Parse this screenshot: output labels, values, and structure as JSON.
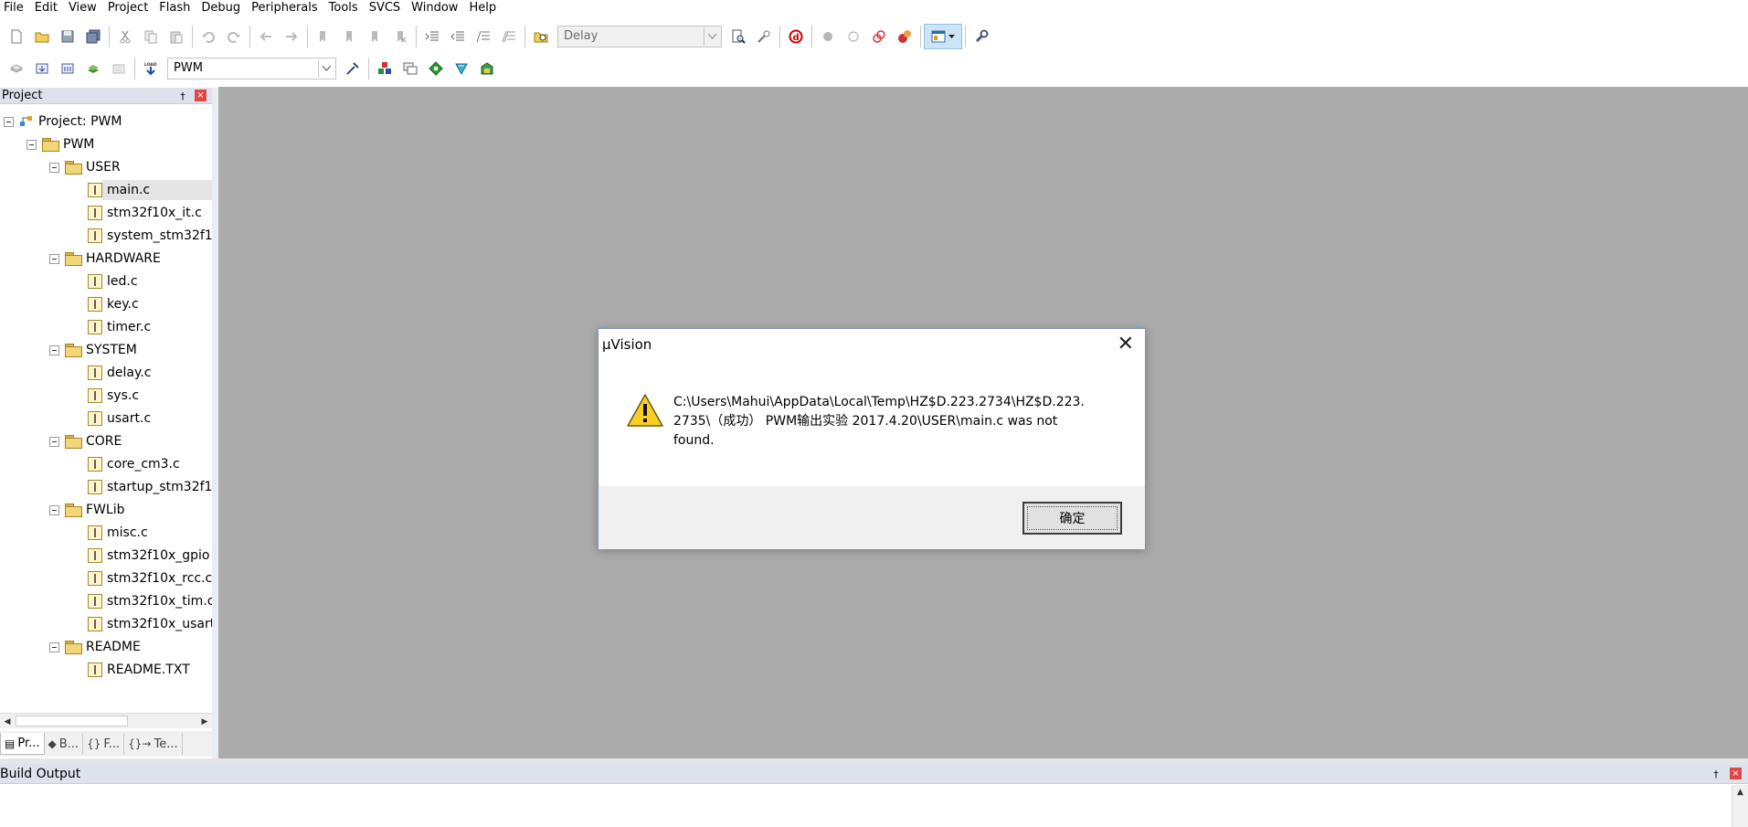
{
  "menu": [
    "File",
    "Edit",
    "View",
    "Project",
    "Flash",
    "Debug",
    "Peripherals",
    "Tools",
    "SVCS",
    "Window",
    "Help"
  ],
  "toolbar1": {
    "find_combo_value": "Delay"
  },
  "toolbar2": {
    "target_combo_value": "PWM"
  },
  "project_panel": {
    "title": "Project",
    "pin_glyph": "†",
    "close_glyph": "×",
    "tree": {
      "root": "Project: PWM",
      "target": "PWM",
      "groups": [
        {
          "name": "USER",
          "files": [
            "main.c",
            "stm32f10x_it.c",
            "system_stm32f1"
          ]
        },
        {
          "name": "HARDWARE",
          "files": [
            "led.c",
            "key.c",
            "timer.c"
          ]
        },
        {
          "name": "SYSTEM",
          "files": [
            "delay.c",
            "sys.c",
            "usart.c"
          ]
        },
        {
          "name": "CORE",
          "files": [
            "core_cm3.c",
            "startup_stm32f1"
          ]
        },
        {
          "name": "FWLib",
          "files": [
            "misc.c",
            "stm32f10x_gpio",
            "stm32f10x_rcc.c",
            "stm32f10x_tim.c",
            "stm32f10x_usart"
          ]
        },
        {
          "name": "README",
          "files": [
            "README.TXT"
          ]
        }
      ]
    },
    "tabs": [
      {
        "glyph": "▤",
        "label": "Pr..."
      },
      {
        "glyph": "◆",
        "label": "B..."
      },
      {
        "glyph": "{}",
        "label": "F..."
      },
      {
        "glyph": "{}→",
        "label": "Te..."
      }
    ]
  },
  "build_output": {
    "title": "Build Output"
  },
  "dialog": {
    "title": "μVision",
    "message_lines": [
      "C:\\Users\\Mahui\\AppData\\Local\\Temp\\HZ$D.223.2734\\HZ$D.223.",
      "2735\\（成功） PWM输出实验  2017.4.20\\USER\\main.c was not",
      "found."
    ],
    "ok_label": "确定",
    "close_glyph": "✕"
  },
  "icons": {
    "toolbar1": [
      "new-file-icon",
      "open-file-icon",
      "save-icon",
      "save-all-icon",
      "cut-icon",
      "copy-icon",
      "paste-icon",
      "undo-icon",
      "redo-icon",
      "navigate-back-icon",
      "navigate-forward-icon",
      "bookmark-icon",
      "bookmark-prev-icon",
      "bookmark-next-icon",
      "bookmark-clear-icon",
      "indent-icon",
      "unindent-icon",
      "comment-icon",
      "uncomment-icon",
      "find-in-files-icon",
      "find-icon",
      "incremental-find-icon",
      "debug-session-icon",
      "breakpoint-insert-icon",
      "breakpoint-enable-icon",
      "breakpoint-disable-icon",
      "breakpoint-kill-icon",
      "window-layout-icon",
      "configure-icon"
    ],
    "toolbar2": [
      "translate-icon",
      "build-icon",
      "rebuild-icon",
      "batch-build-icon",
      "stop-build-icon",
      "download-icon",
      "target-options-icon",
      "manage-components-icon",
      "select-pack-icon",
      "pack-installer-icon",
      "manage-rte-icon",
      "file-extensions-icon"
    ]
  },
  "colors": {
    "accent": "#3399ff",
    "workspace_bg": "#ababab",
    "panel_title_bg": "#dde2ec",
    "warning_yellow": "#f7d023",
    "close_red": "#e04848"
  }
}
